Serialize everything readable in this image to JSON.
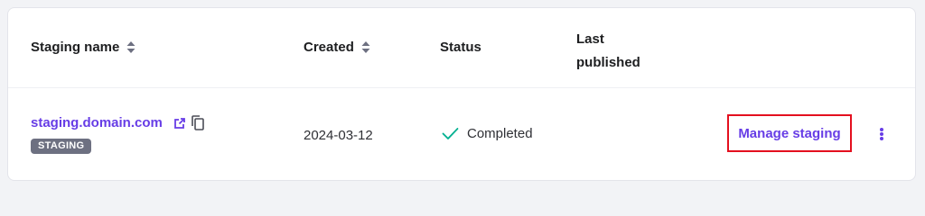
{
  "table": {
    "headers": {
      "staging_name": "Staging name",
      "created": "Created",
      "status": "Status",
      "last_published_line1": "Last",
      "last_published_line2": "published"
    },
    "rows": [
      {
        "staging_name": "staging.domain.com",
        "badge": "STAGING",
        "created": "2024-03-12",
        "status": "Completed",
        "last_published": "",
        "action_label": "Manage staging"
      }
    ]
  },
  "icons": {
    "sort": "sort-icon",
    "external_link": "external-link-icon",
    "copy": "copy-icon",
    "status_check": "check-icon",
    "more": "more-vertical-icon"
  },
  "colors": {
    "accent": "#673de6",
    "status_success": "#00b090",
    "badge_bg": "#6d7081",
    "highlight_border": "#e4101f"
  }
}
